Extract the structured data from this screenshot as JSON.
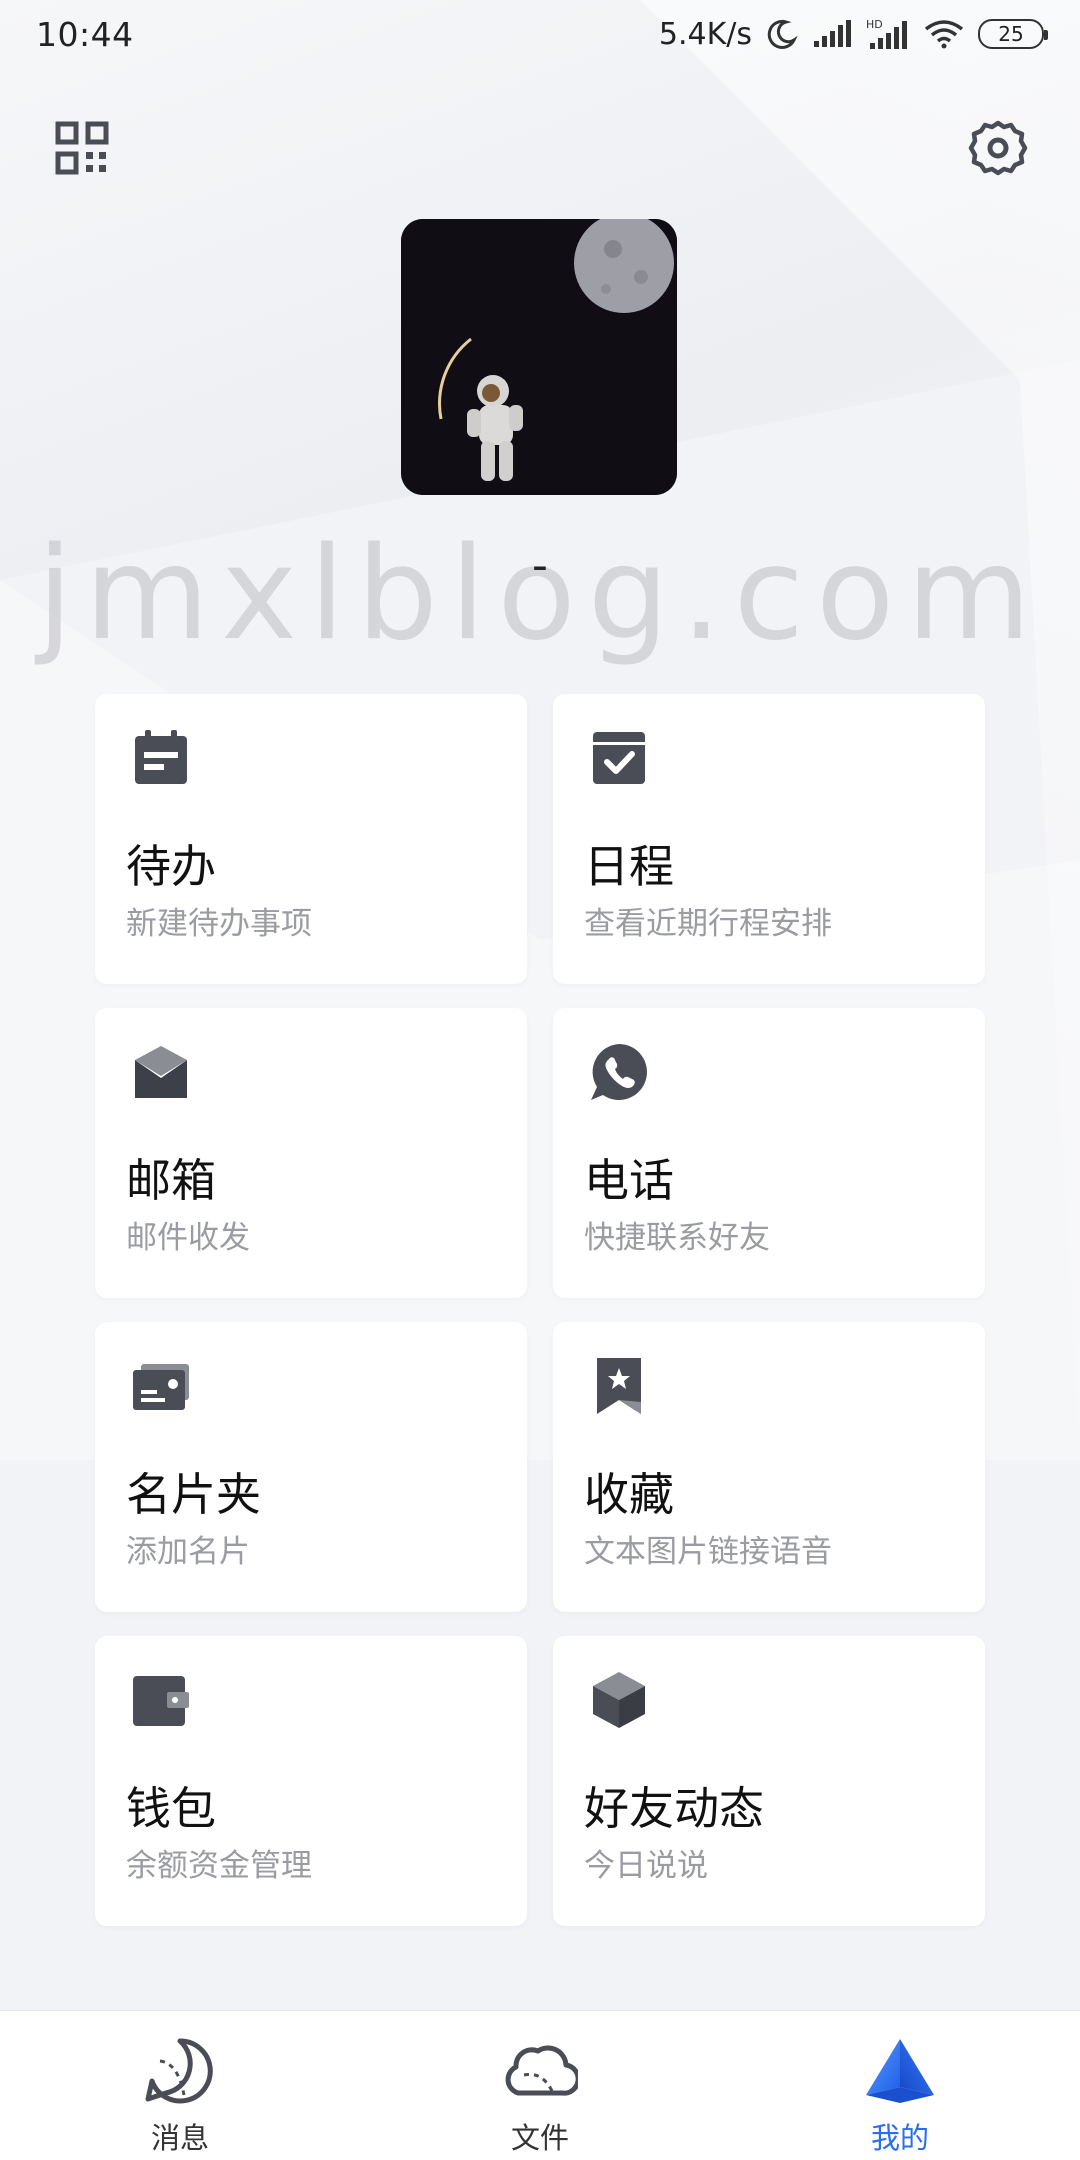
{
  "status_bar": {
    "time": "10:44",
    "net_speed": "5.4K/s",
    "battery": "25",
    "icons": [
      "moon-icon",
      "signal-icon",
      "hd-signal-icon",
      "wifi-icon",
      "battery-icon"
    ]
  },
  "header": {
    "left_icon": "qr-code-icon",
    "right_icon": "gear-icon"
  },
  "profile": {
    "avatar": "astronaut-on-moon-avatar",
    "username": "-",
    "watermark": "jmxlblog.com"
  },
  "cards": [
    {
      "icon": "todo-calendar-icon",
      "title": "待办",
      "subtitle": "新建待办事项"
    },
    {
      "icon": "calendar-check-icon",
      "title": "日程",
      "subtitle": "查看近期行程安排"
    },
    {
      "icon": "mail-icon",
      "title": "邮箱",
      "subtitle": "邮件收发"
    },
    {
      "icon": "phone-icon",
      "title": "电话",
      "subtitle": "快捷联系好友"
    },
    {
      "icon": "business-card-icon",
      "title": "名片夹",
      "subtitle": "添加名片"
    },
    {
      "icon": "bookmark-star-icon",
      "title": "收藏",
      "subtitle": "文本图片链接语音"
    },
    {
      "icon": "wallet-icon",
      "title": "钱包",
      "subtitle": "余额资金管理"
    },
    {
      "icon": "cube-icon",
      "title": "好友动态",
      "subtitle": "今日说说"
    }
  ],
  "bottom_nav": {
    "items": [
      {
        "label": "消息",
        "icon": "message-bubble-icon"
      },
      {
        "label": "文件",
        "icon": "cloud-icon"
      },
      {
        "label": "我的",
        "icon": "mine-triangle-icon"
      }
    ],
    "active_index": 2,
    "active_color": "#2a6df4"
  },
  "colors": {
    "icon_gray": "#4a4d55",
    "background": "#f2f3f6",
    "subtitle": "#9a9ca2"
  }
}
